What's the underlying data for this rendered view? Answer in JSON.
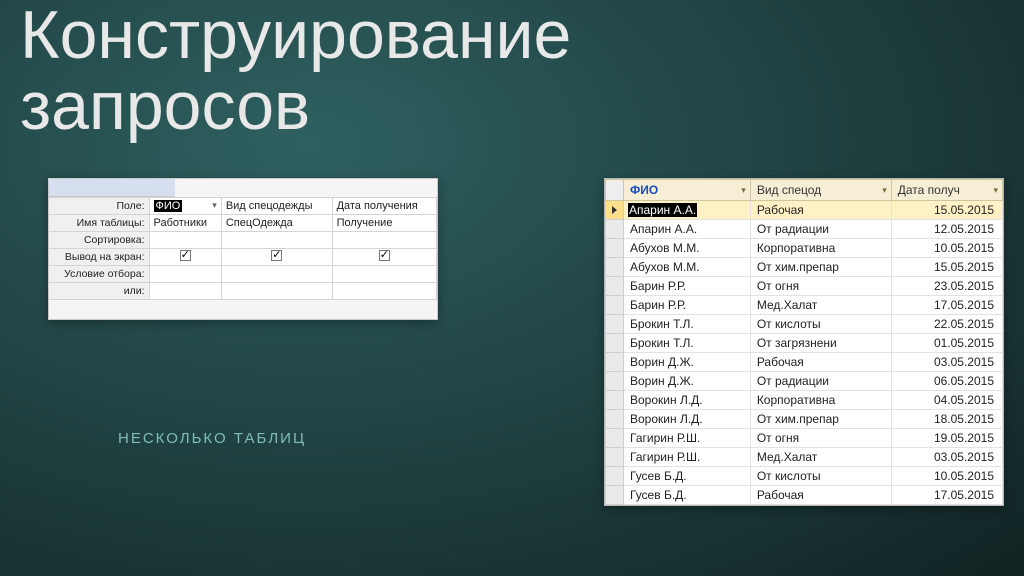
{
  "title_line1": "Конструирование",
  "title_line2": "запросов",
  "subtitle": "НЕСКОЛЬКО ТАБЛИЦ",
  "designer": {
    "rows": {
      "field": "Поле:",
      "table": "Имя таблицы:",
      "sort": "Сортировка:",
      "show": "Вывод на экран:",
      "criteria": "Условие отбора:",
      "or": "или:"
    },
    "cols": [
      {
        "field": "ФИО",
        "table": "Работники",
        "show": true,
        "selected": true
      },
      {
        "field": "Вид спецодежды",
        "table": "СпецОдежда",
        "show": true,
        "selected": false
      },
      {
        "field": "Дата получения",
        "table": "Получение",
        "show": true,
        "selected": false
      }
    ]
  },
  "datasheet": {
    "headers": {
      "fio": "ФИО",
      "type": "Вид спецод",
      "date": "Дата получ"
    },
    "rows": [
      {
        "fio": "Апарин А.А.",
        "type": "Рабочая",
        "date": "15.05.2015",
        "sel": true
      },
      {
        "fio": "Апарин А.А.",
        "type": "От радиации",
        "date": "12.05.2015"
      },
      {
        "fio": "Абухов М.М.",
        "type": "Корпоративна",
        "date": "10.05.2015"
      },
      {
        "fio": "Абухов М.М.",
        "type": "От хим.препар",
        "date": "15.05.2015"
      },
      {
        "fio": "Барин Р.Р.",
        "type": "От огня",
        "date": "23.05.2015"
      },
      {
        "fio": "Барин Р.Р.",
        "type": "Мед.Халат",
        "date": "17.05.2015"
      },
      {
        "fio": "Брокин Т.Л.",
        "type": "От кислоты",
        "date": "22.05.2015"
      },
      {
        "fio": "Брокин Т.Л.",
        "type": "От загрязнени",
        "date": "01.05.2015"
      },
      {
        "fio": "Ворин Д.Ж.",
        "type": "Рабочая",
        "date": "03.05.2015"
      },
      {
        "fio": "Ворин Д.Ж.",
        "type": "От радиации",
        "date": "06.05.2015"
      },
      {
        "fio": "Ворокин Л.Д.",
        "type": "Корпоративна",
        "date": "04.05.2015"
      },
      {
        "fio": "Ворокин Л.Д.",
        "type": "От хим.препар",
        "date": "18.05.2015"
      },
      {
        "fio": "Гагирин Р.Ш.",
        "type": "От огня",
        "date": "19.05.2015"
      },
      {
        "fio": "Гагирин Р.Ш.",
        "type": "Мед.Халат",
        "date": "03.05.2015"
      },
      {
        "fio": "Гусев Б.Д.",
        "type": "От кислоты",
        "date": "10.05.2015"
      },
      {
        "fio": "Гусев Б.Д.",
        "type": "Рабочая",
        "date": "17.05.2015"
      }
    ]
  }
}
